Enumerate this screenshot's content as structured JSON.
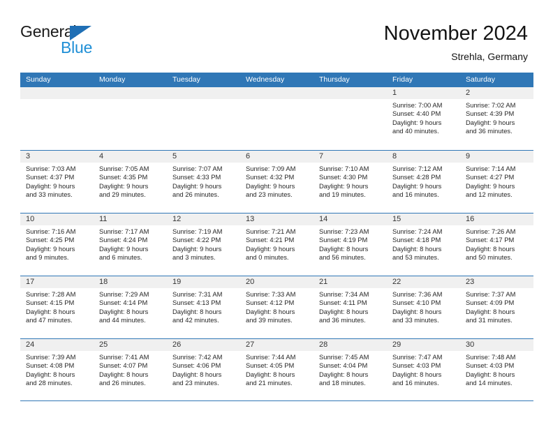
{
  "brand": {
    "name_part1": "General",
    "name_part2": "Blue",
    "accent_color": "#1f8fd6",
    "triangle_color": "#1f6fb5"
  },
  "header": {
    "title": "November 2024",
    "subtitle": "Strehla, Germany"
  },
  "theme": {
    "header_blue": "#3077b6",
    "daynum_band": "#f0f0f0",
    "text": "#262626"
  },
  "weekdays": [
    "Sunday",
    "Monday",
    "Tuesday",
    "Wednesday",
    "Thursday",
    "Friday",
    "Saturday"
  ],
  "weeks": [
    [
      {
        "day": "",
        "blank": true,
        "sunrise": "",
        "sunset": "",
        "daylight_line1": "",
        "daylight_line2": ""
      },
      {
        "day": "",
        "blank": true,
        "sunrise": "",
        "sunset": "",
        "daylight_line1": "",
        "daylight_line2": ""
      },
      {
        "day": "",
        "blank": true,
        "sunrise": "",
        "sunset": "",
        "daylight_line1": "",
        "daylight_line2": ""
      },
      {
        "day": "",
        "blank": true,
        "sunrise": "",
        "sunset": "",
        "daylight_line1": "",
        "daylight_line2": ""
      },
      {
        "day": "",
        "blank": true,
        "sunrise": "",
        "sunset": "",
        "daylight_line1": "",
        "daylight_line2": ""
      },
      {
        "day": "1",
        "blank": false,
        "sunrise": "Sunrise: 7:00 AM",
        "sunset": "Sunset: 4:40 PM",
        "daylight_line1": "Daylight: 9 hours",
        "daylight_line2": "and 40 minutes."
      },
      {
        "day": "2",
        "blank": false,
        "sunrise": "Sunrise: 7:02 AM",
        "sunset": "Sunset: 4:39 PM",
        "daylight_line1": "Daylight: 9 hours",
        "daylight_line2": "and 36 minutes."
      }
    ],
    [
      {
        "day": "3",
        "blank": false,
        "sunrise": "Sunrise: 7:03 AM",
        "sunset": "Sunset: 4:37 PM",
        "daylight_line1": "Daylight: 9 hours",
        "daylight_line2": "and 33 minutes."
      },
      {
        "day": "4",
        "blank": false,
        "sunrise": "Sunrise: 7:05 AM",
        "sunset": "Sunset: 4:35 PM",
        "daylight_line1": "Daylight: 9 hours",
        "daylight_line2": "and 29 minutes."
      },
      {
        "day": "5",
        "blank": false,
        "sunrise": "Sunrise: 7:07 AM",
        "sunset": "Sunset: 4:33 PM",
        "daylight_line1": "Daylight: 9 hours",
        "daylight_line2": "and 26 minutes."
      },
      {
        "day": "6",
        "blank": false,
        "sunrise": "Sunrise: 7:09 AM",
        "sunset": "Sunset: 4:32 PM",
        "daylight_line1": "Daylight: 9 hours",
        "daylight_line2": "and 23 minutes."
      },
      {
        "day": "7",
        "blank": false,
        "sunrise": "Sunrise: 7:10 AM",
        "sunset": "Sunset: 4:30 PM",
        "daylight_line1": "Daylight: 9 hours",
        "daylight_line2": "and 19 minutes."
      },
      {
        "day": "8",
        "blank": false,
        "sunrise": "Sunrise: 7:12 AM",
        "sunset": "Sunset: 4:28 PM",
        "daylight_line1": "Daylight: 9 hours",
        "daylight_line2": "and 16 minutes."
      },
      {
        "day": "9",
        "blank": false,
        "sunrise": "Sunrise: 7:14 AM",
        "sunset": "Sunset: 4:27 PM",
        "daylight_line1": "Daylight: 9 hours",
        "daylight_line2": "and 12 minutes."
      }
    ],
    [
      {
        "day": "10",
        "blank": false,
        "sunrise": "Sunrise: 7:16 AM",
        "sunset": "Sunset: 4:25 PM",
        "daylight_line1": "Daylight: 9 hours",
        "daylight_line2": "and 9 minutes."
      },
      {
        "day": "11",
        "blank": false,
        "sunrise": "Sunrise: 7:17 AM",
        "sunset": "Sunset: 4:24 PM",
        "daylight_line1": "Daylight: 9 hours",
        "daylight_line2": "and 6 minutes."
      },
      {
        "day": "12",
        "blank": false,
        "sunrise": "Sunrise: 7:19 AM",
        "sunset": "Sunset: 4:22 PM",
        "daylight_line1": "Daylight: 9 hours",
        "daylight_line2": "and 3 minutes."
      },
      {
        "day": "13",
        "blank": false,
        "sunrise": "Sunrise: 7:21 AM",
        "sunset": "Sunset: 4:21 PM",
        "daylight_line1": "Daylight: 9 hours",
        "daylight_line2": "and 0 minutes."
      },
      {
        "day": "14",
        "blank": false,
        "sunrise": "Sunrise: 7:23 AM",
        "sunset": "Sunset: 4:19 PM",
        "daylight_line1": "Daylight: 8 hours",
        "daylight_line2": "and 56 minutes."
      },
      {
        "day": "15",
        "blank": false,
        "sunrise": "Sunrise: 7:24 AM",
        "sunset": "Sunset: 4:18 PM",
        "daylight_line1": "Daylight: 8 hours",
        "daylight_line2": "and 53 minutes."
      },
      {
        "day": "16",
        "blank": false,
        "sunrise": "Sunrise: 7:26 AM",
        "sunset": "Sunset: 4:17 PM",
        "daylight_line1": "Daylight: 8 hours",
        "daylight_line2": "and 50 minutes."
      }
    ],
    [
      {
        "day": "17",
        "blank": false,
        "sunrise": "Sunrise: 7:28 AM",
        "sunset": "Sunset: 4:15 PM",
        "daylight_line1": "Daylight: 8 hours",
        "daylight_line2": "and 47 minutes."
      },
      {
        "day": "18",
        "blank": false,
        "sunrise": "Sunrise: 7:29 AM",
        "sunset": "Sunset: 4:14 PM",
        "daylight_line1": "Daylight: 8 hours",
        "daylight_line2": "and 44 minutes."
      },
      {
        "day": "19",
        "blank": false,
        "sunrise": "Sunrise: 7:31 AM",
        "sunset": "Sunset: 4:13 PM",
        "daylight_line1": "Daylight: 8 hours",
        "daylight_line2": "and 42 minutes."
      },
      {
        "day": "20",
        "blank": false,
        "sunrise": "Sunrise: 7:33 AM",
        "sunset": "Sunset: 4:12 PM",
        "daylight_line1": "Daylight: 8 hours",
        "daylight_line2": "and 39 minutes."
      },
      {
        "day": "21",
        "blank": false,
        "sunrise": "Sunrise: 7:34 AM",
        "sunset": "Sunset: 4:11 PM",
        "daylight_line1": "Daylight: 8 hours",
        "daylight_line2": "and 36 minutes."
      },
      {
        "day": "22",
        "blank": false,
        "sunrise": "Sunrise: 7:36 AM",
        "sunset": "Sunset: 4:10 PM",
        "daylight_line1": "Daylight: 8 hours",
        "daylight_line2": "and 33 minutes."
      },
      {
        "day": "23",
        "blank": false,
        "sunrise": "Sunrise: 7:37 AM",
        "sunset": "Sunset: 4:09 PM",
        "daylight_line1": "Daylight: 8 hours",
        "daylight_line2": "and 31 minutes."
      }
    ],
    [
      {
        "day": "24",
        "blank": false,
        "sunrise": "Sunrise: 7:39 AM",
        "sunset": "Sunset: 4:08 PM",
        "daylight_line1": "Daylight: 8 hours",
        "daylight_line2": "and 28 minutes."
      },
      {
        "day": "25",
        "blank": false,
        "sunrise": "Sunrise: 7:41 AM",
        "sunset": "Sunset: 4:07 PM",
        "daylight_line1": "Daylight: 8 hours",
        "daylight_line2": "and 26 minutes."
      },
      {
        "day": "26",
        "blank": false,
        "sunrise": "Sunrise: 7:42 AM",
        "sunset": "Sunset: 4:06 PM",
        "daylight_line1": "Daylight: 8 hours",
        "daylight_line2": "and 23 minutes."
      },
      {
        "day": "27",
        "blank": false,
        "sunrise": "Sunrise: 7:44 AM",
        "sunset": "Sunset: 4:05 PM",
        "daylight_line1": "Daylight: 8 hours",
        "daylight_line2": "and 21 minutes."
      },
      {
        "day": "28",
        "blank": false,
        "sunrise": "Sunrise: 7:45 AM",
        "sunset": "Sunset: 4:04 PM",
        "daylight_line1": "Daylight: 8 hours",
        "daylight_line2": "and 18 minutes."
      },
      {
        "day": "29",
        "blank": false,
        "sunrise": "Sunrise: 7:47 AM",
        "sunset": "Sunset: 4:03 PM",
        "daylight_line1": "Daylight: 8 hours",
        "daylight_line2": "and 16 minutes."
      },
      {
        "day": "30",
        "blank": false,
        "sunrise": "Sunrise: 7:48 AM",
        "sunset": "Sunset: 4:03 PM",
        "daylight_line1": "Daylight: 8 hours",
        "daylight_line2": "and 14 minutes."
      }
    ]
  ]
}
